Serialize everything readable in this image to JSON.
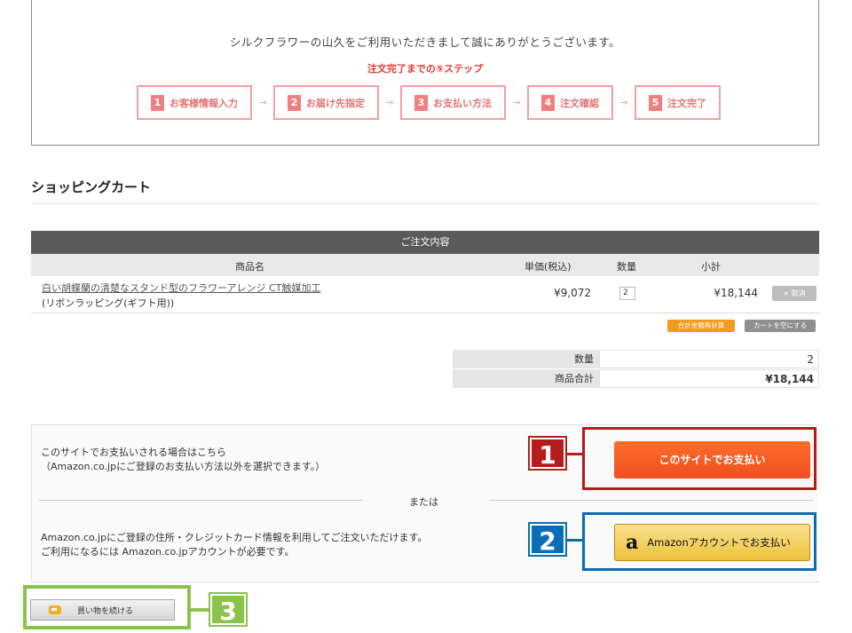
{
  "header": {
    "thanks": "シルクフラワーの山久をご利用いただきまして誠にありがとうございます。",
    "steps_title": "注文完了までの⑤ステップ",
    "steps": [
      {
        "num": "1",
        "label": "お客様情報入力"
      },
      {
        "num": "2",
        "label": "お届け先指定"
      },
      {
        "num": "3",
        "label": "お支払い方法"
      },
      {
        "num": "4",
        "label": "注文確認"
      },
      {
        "num": "5",
        "label": "注文完了"
      }
    ],
    "arrow": "→"
  },
  "section_title": "ショッピングカート",
  "cart": {
    "heading": "ご注文内容",
    "columns": {
      "name": "商品名",
      "unit_price": "単価(税込)",
      "qty": "数量",
      "subtotal": "小計"
    },
    "item": {
      "name": "白い胡蝶蘭の清楚なスタンド型のフラワーアレンジ CT触媒加工",
      "option": "(リボンラッピング(ギフト用))",
      "unit_price": "¥9,072",
      "qty": "2",
      "subtotal": "¥18,144",
      "cancel_label": "× 取消"
    },
    "recalc_label": "合計金額再計算",
    "empty_label": "カートを空にする"
  },
  "summary": {
    "qty_label": "数量",
    "qty_value": "2",
    "total_label": "商品合計",
    "total_value": "¥18,144"
  },
  "payment": {
    "site_text_line1": "このサイトでお支払いされる場合はこちら",
    "site_text_line2": "（Amazon.co.jpにご登録のお支払い方法以外を選択できます。）",
    "site_button": "このサイトでお支払い",
    "or_text": "または",
    "amazon_text_line1": "Amazon.co.jpにご登録の住所・クレジットカード情報を利用してご注文いただけます。",
    "amazon_text_line2": "ご利用になるには Amazon.co.jpアカウントが必要です。",
    "amazon_logo": "a",
    "amazon_button": "Amazonアカウントでお支払い"
  },
  "continue_button": "買い物を続ける",
  "badges": {
    "one": "1",
    "two": "2",
    "three": "3"
  },
  "colors": {
    "accent_red": "#e53935",
    "pay_orange": "#f04e1e",
    "amazon_yellow": "#efc23d",
    "annotation_red": "#b71c1c",
    "annotation_blue": "#0a6db5",
    "annotation_green": "#8bc34a"
  }
}
